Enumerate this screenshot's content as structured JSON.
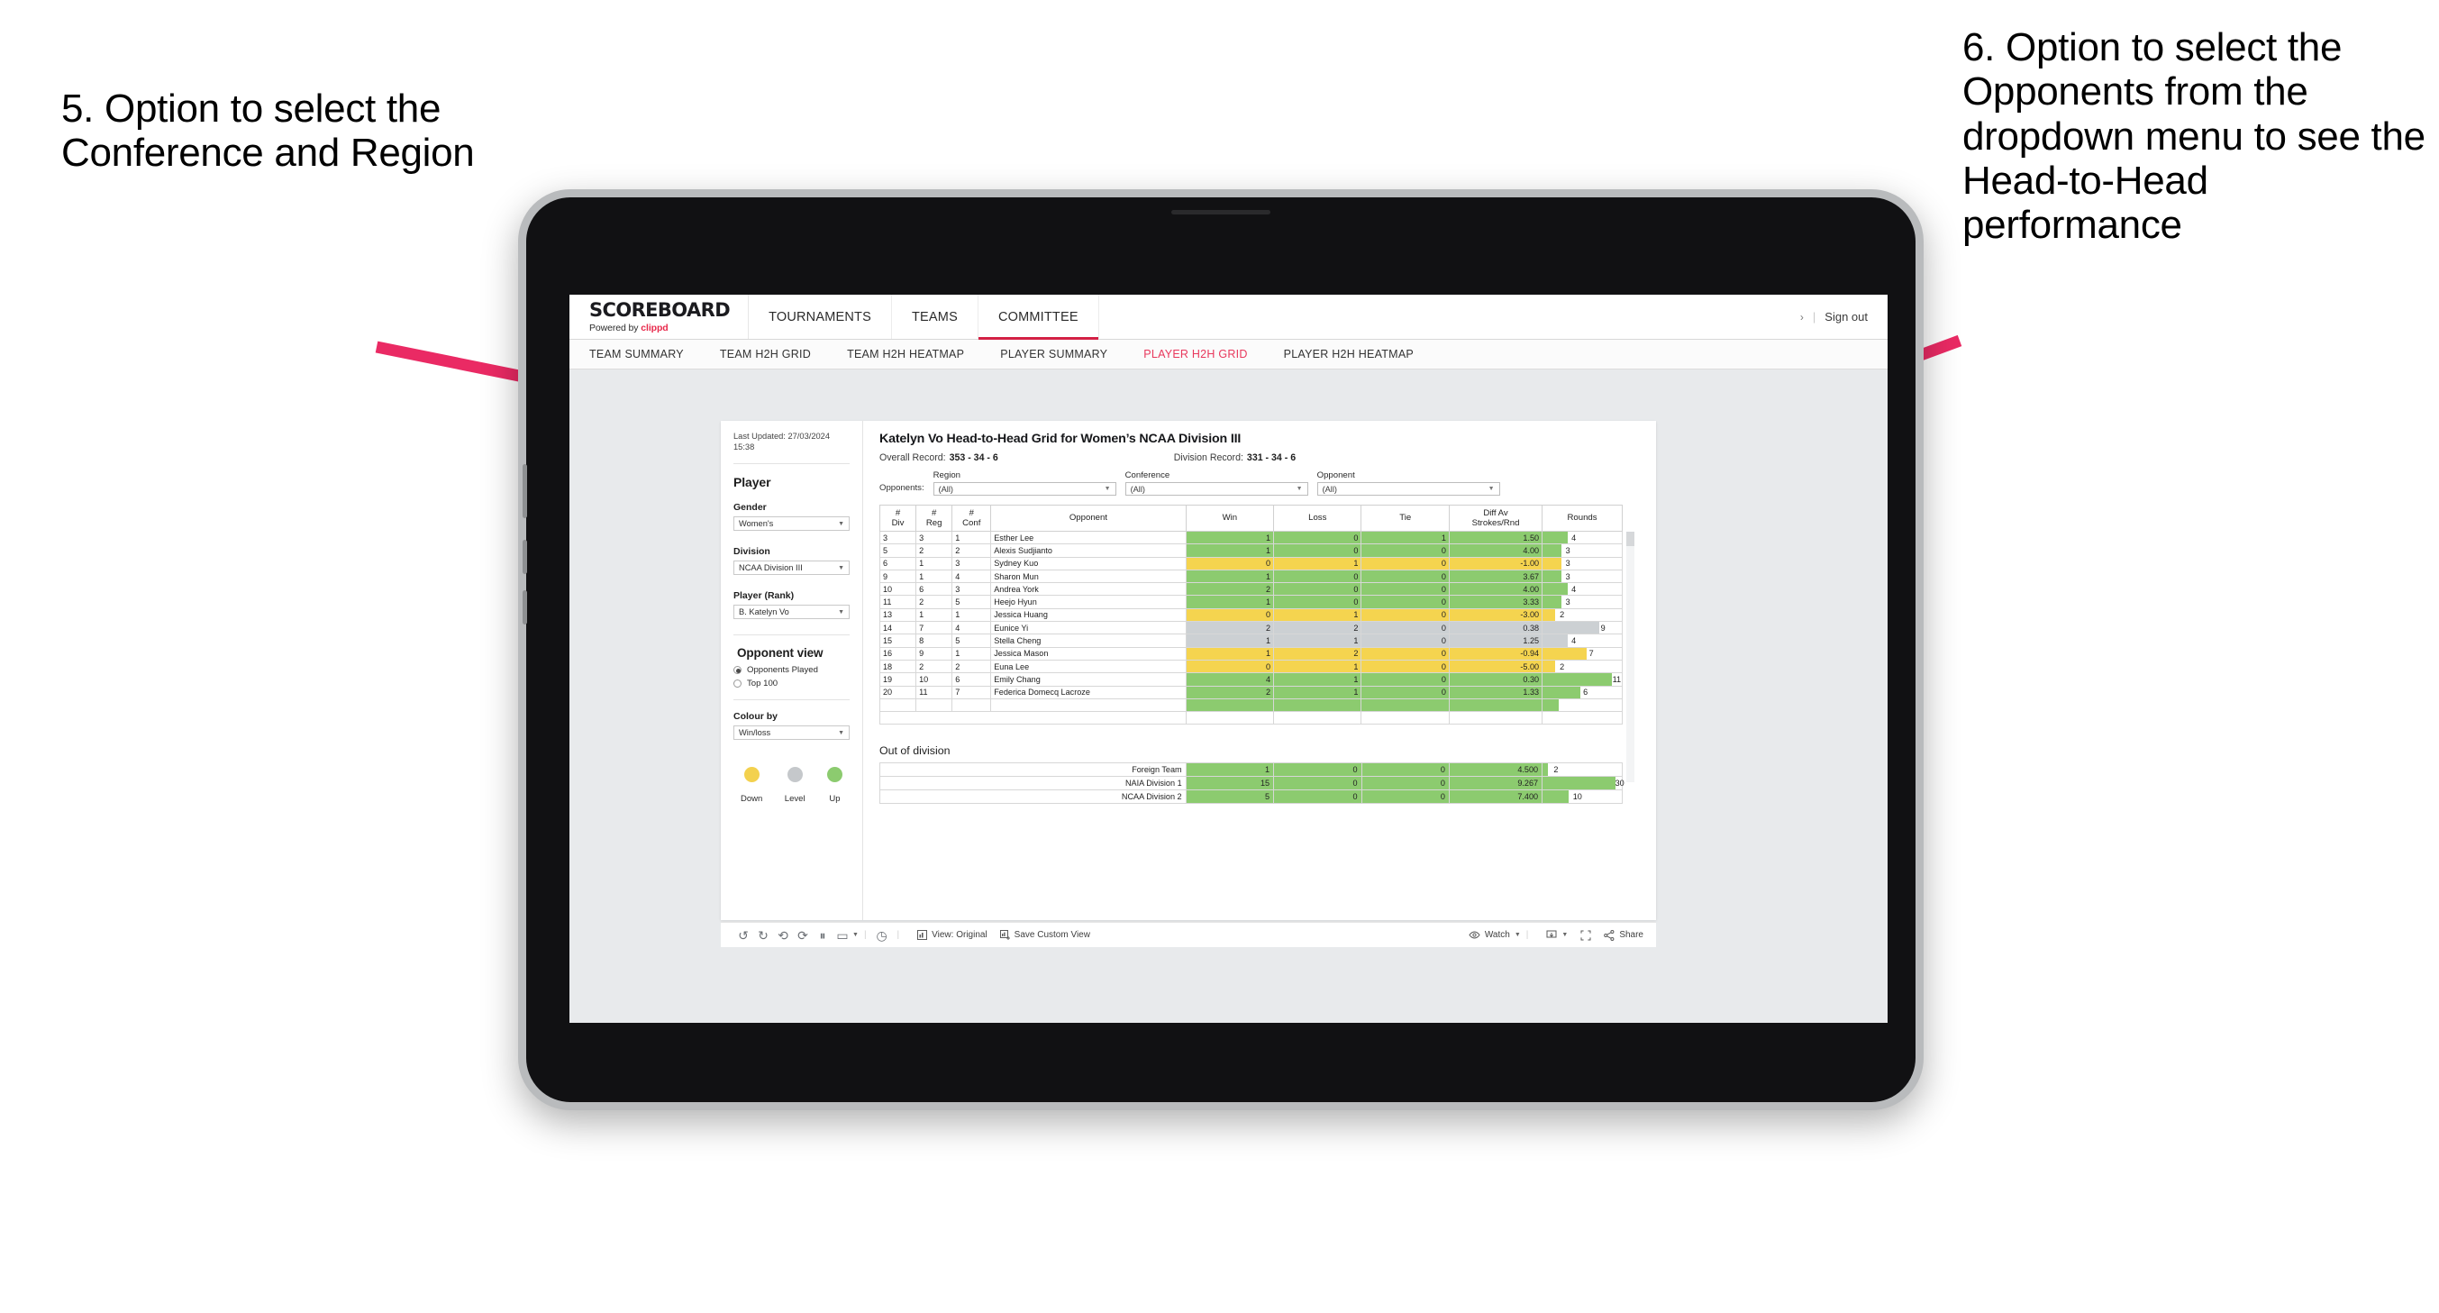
{
  "annotations": {
    "left": "5. Option to select the Conference and Region",
    "right": "6. Option to select the Opponents from the dropdown menu to see the Head-to-Head performance"
  },
  "brand": {
    "title": "SCOREBOARD",
    "powered_prefix": "Powered by ",
    "powered_name": "clippd"
  },
  "topnav": {
    "tabs": [
      {
        "label": "TOURNAMENTS",
        "active": false
      },
      {
        "label": "TEAMS",
        "active": false
      },
      {
        "label": "COMMITTEE",
        "active": true
      }
    ],
    "chevron": "›",
    "divider": "|",
    "signout": "Sign out"
  },
  "subnav": {
    "tabs": [
      {
        "label": "TEAM SUMMARY",
        "active": false
      },
      {
        "label": "TEAM H2H GRID",
        "active": false
      },
      {
        "label": "TEAM H2H HEATMAP",
        "active": false
      },
      {
        "label": "PLAYER SUMMARY",
        "active": false
      },
      {
        "label": "PLAYER H2H GRID",
        "active": true
      },
      {
        "label": "PLAYER H2H HEATMAP",
        "active": false
      }
    ]
  },
  "sidebar": {
    "last_updated": "Last Updated: 27/03/2024 15:38",
    "player_heading": "Player",
    "filters": [
      {
        "label": "Gender",
        "value": "Women's"
      },
      {
        "label": "Division",
        "value": "NCAA Division III"
      },
      {
        "label": "Player (Rank)",
        "value": "B. Katelyn Vo"
      }
    ],
    "opponent_view": {
      "heading": "Opponent view",
      "options": [
        {
          "label": "Opponents Played",
          "selected": true
        },
        {
          "label": "Top 100",
          "selected": false
        }
      ]
    },
    "colour_by": {
      "label": "Colour by",
      "value": "Win/loss"
    },
    "legend": [
      {
        "label": "Down",
        "color": "#f3d14e"
      },
      {
        "label": "Level",
        "color": "#c5c8cb"
      },
      {
        "label": "Up",
        "color": "#8ccb6f"
      }
    ]
  },
  "viz": {
    "title": "Katelyn Vo Head-to-Head Grid for Women’s NCAA Division III",
    "overall_record_label": "Overall Record:",
    "overall_record_value": "353 -  34 - 6",
    "division_record_label": "Division Record:",
    "division_record_value": "331 -  34 - 6",
    "opponents_label": "Opponents:",
    "filters": [
      {
        "label": "Region",
        "value": "(All)"
      },
      {
        "label": "Conference",
        "value": "(All)"
      },
      {
        "label": "Opponent",
        "value": "(All)"
      }
    ]
  },
  "chart_data": {
    "type": "table",
    "title": "Katelyn Vo Head-to-Head Grid for Women’s NCAA Division III",
    "columns": [
      "# Div",
      "# Reg",
      "# Conf",
      "Opponent",
      "Win",
      "Loss",
      "Tie",
      "Diff Av Strokes/Rnd",
      "Rounds"
    ],
    "column_headers_twoline": [
      {
        "l1": "#",
        "l2": "Div"
      },
      {
        "l1": "#",
        "l2": "Reg"
      },
      {
        "l1": "#",
        "l2": "Conf"
      },
      {
        "l1": "Opponent",
        "l2": ""
      },
      {
        "l1": "Win",
        "l2": ""
      },
      {
        "l1": "Loss",
        "l2": ""
      },
      {
        "l1": "Tie",
        "l2": ""
      },
      {
        "l1": "Diff Av",
        "l2": "Strokes/Rnd"
      },
      {
        "l1": "Rounds",
        "l2": ""
      }
    ],
    "rounds_max": 30,
    "rows": [
      {
        "div": "3",
        "reg": "3",
        "conf": "1",
        "opponent": "Esther Lee",
        "win": "1",
        "loss": "0",
        "tie": "1",
        "diff": "1.50",
        "rounds": "4",
        "state": "up"
      },
      {
        "div": "5",
        "reg": "2",
        "conf": "2",
        "opponent": "Alexis Sudjianto",
        "win": "1",
        "loss": "0",
        "tie": "0",
        "diff": "4.00",
        "rounds": "3",
        "state": "up"
      },
      {
        "div": "6",
        "reg": "1",
        "conf": "3",
        "opponent": "Sydney Kuo",
        "win": "0",
        "loss": "1",
        "tie": "0",
        "diff": "-1.00",
        "rounds": "3",
        "state": "down"
      },
      {
        "div": "9",
        "reg": "1",
        "conf": "4",
        "opponent": "Sharon Mun",
        "win": "1",
        "loss": "0",
        "tie": "0",
        "diff": "3.67",
        "rounds": "3",
        "state": "up"
      },
      {
        "div": "10",
        "reg": "6",
        "conf": "3",
        "opponent": "Andrea York",
        "win": "2",
        "loss": "0",
        "tie": "0",
        "diff": "4.00",
        "rounds": "4",
        "state": "up"
      },
      {
        "div": "11",
        "reg": "2",
        "conf": "5",
        "opponent": "Heejo Hyun",
        "win": "1",
        "loss": "0",
        "tie": "0",
        "diff": "3.33",
        "rounds": "3",
        "state": "up"
      },
      {
        "div": "13",
        "reg": "1",
        "conf": "1",
        "opponent": "Jessica Huang",
        "win": "0",
        "loss": "1",
        "tie": "0",
        "diff": "-3.00",
        "rounds": "2",
        "state": "down"
      },
      {
        "div": "14",
        "reg": "7",
        "conf": "4",
        "opponent": "Eunice Yi",
        "win": "2",
        "loss": "2",
        "tie": "0",
        "diff": "0.38",
        "rounds": "9",
        "state": "level"
      },
      {
        "div": "15",
        "reg": "8",
        "conf": "5",
        "opponent": "Stella Cheng",
        "win": "1",
        "loss": "1",
        "tie": "0",
        "diff": "1.25",
        "rounds": "4",
        "state": "level"
      },
      {
        "div": "16",
        "reg": "9",
        "conf": "1",
        "opponent": "Jessica Mason",
        "win": "1",
        "loss": "2",
        "tie": "0",
        "diff": "-0.94",
        "rounds": "7",
        "state": "down"
      },
      {
        "div": "18",
        "reg": "2",
        "conf": "2",
        "opponent": "Euna Lee",
        "win": "0",
        "loss": "1",
        "tie": "0",
        "diff": "-5.00",
        "rounds": "2",
        "state": "down"
      },
      {
        "div": "19",
        "reg": "10",
        "conf": "6",
        "opponent": "Emily Chang",
        "win": "4",
        "loss": "1",
        "tie": "0",
        "diff": "0.30",
        "rounds": "11",
        "state": "up"
      },
      {
        "div": "20",
        "reg": "11",
        "conf": "7",
        "opponent": "Federica Domecq Lacroze",
        "win": "2",
        "loss": "1",
        "tie": "0",
        "diff": "1.33",
        "rounds": "6",
        "state": "up"
      }
    ],
    "out_of_division": {
      "title": "Out of division",
      "rows": [
        {
          "name": "Foreign Team",
          "win": "1",
          "loss": "0",
          "tie": "0",
          "diff": "4.500",
          "rounds": "2",
          "state": "up"
        },
        {
          "name": "NAIA Division 1",
          "win": "15",
          "loss": "0",
          "tie": "0",
          "diff": "9.267",
          "rounds": "30",
          "state": "up"
        },
        {
          "name": "NCAA Division 2",
          "win": "5",
          "loss": "0",
          "tie": "0",
          "diff": "7.400",
          "rounds": "10",
          "state": "up"
        }
      ]
    }
  },
  "toolbar": {
    "icons": [
      "undo-icon",
      "redo-icon",
      "revert-icon",
      "refresh-icon",
      "pause-icon",
      "highlight-icon"
    ],
    "view_label": "View: Original",
    "save_label": "Save Custom View",
    "watch_label": "Watch",
    "share_label": "Share"
  },
  "colors": {
    "accent": "#e8294b",
    "up": "#8ccb6f",
    "down": "#f5d44f",
    "level": "#ccd0d3",
    "arrow": "#ea2a64"
  }
}
